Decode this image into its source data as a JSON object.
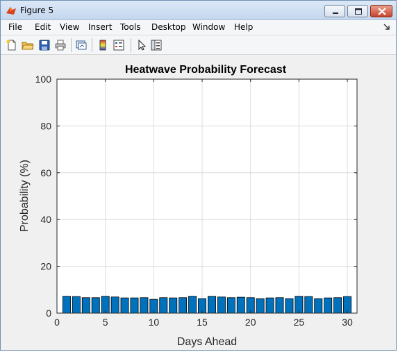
{
  "window": {
    "title": "Figure 5"
  },
  "menubar": {
    "items": [
      "File",
      "Edit",
      "View",
      "Insert",
      "Tools",
      "Desktop",
      "Window",
      "Help"
    ]
  },
  "toolbar": {
    "buttons": [
      "new-figure-icon",
      "open-file-icon",
      "save-icon",
      "print-icon",
      "link-plot-icon",
      "insert-colorbar-icon",
      "insert-legend-icon",
      "edit-plot-arrow-icon",
      "property-inspector-icon"
    ]
  },
  "chart_data": {
    "type": "bar",
    "title": "Heatwave Probability Forecast",
    "xlabel": "Days Ahead",
    "ylabel": "Probability (%)",
    "xlim": [
      0,
      31
    ],
    "ylim": [
      0,
      100
    ],
    "xticks": [
      0,
      5,
      10,
      15,
      20,
      25,
      30
    ],
    "yticks": [
      0,
      20,
      40,
      60,
      80,
      100
    ],
    "grid": true,
    "bar_color": "#0072bd",
    "x": [
      1,
      2,
      3,
      4,
      5,
      6,
      7,
      8,
      9,
      10,
      11,
      12,
      13,
      14,
      15,
      16,
      17,
      18,
      19,
      20,
      21,
      22,
      23,
      24,
      25,
      26,
      27,
      28,
      29,
      30
    ],
    "values": [
      7.2,
      7.1,
      6.6,
      6.6,
      7.2,
      6.9,
      6.5,
      6.5,
      6.6,
      5.9,
      6.6,
      6.5,
      6.6,
      7.2,
      6.2,
      7.2,
      6.9,
      6.6,
      6.8,
      6.6,
      6.2,
      6.5,
      6.6,
      6.2,
      7.2,
      7.1,
      6.2,
      6.5,
      6.6,
      7.1
    ]
  }
}
